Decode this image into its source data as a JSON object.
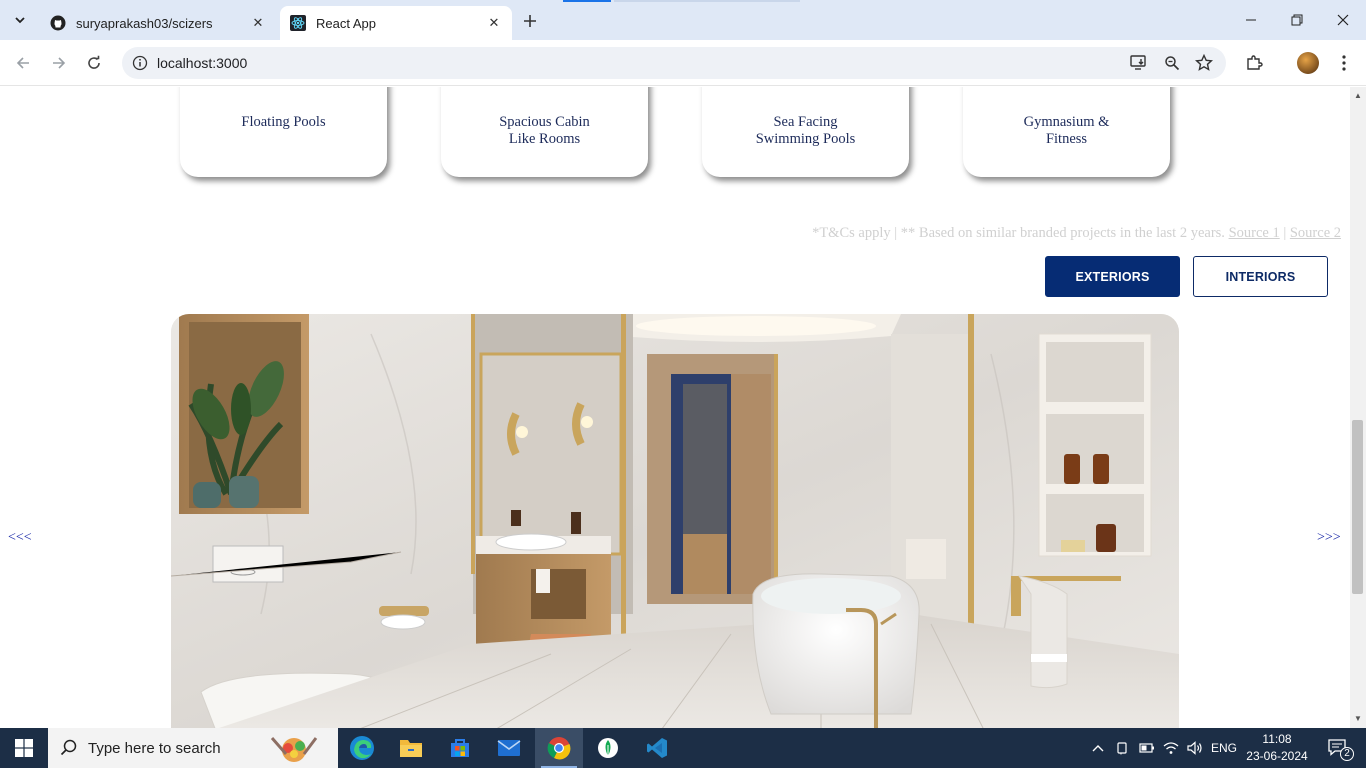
{
  "browser": {
    "tabs": [
      {
        "title": "suryaprakash03/scizers",
        "icon": "github-icon"
      },
      {
        "title": "React App",
        "icon": "react-icon"
      }
    ],
    "url": "localhost:3000",
    "window_controls": [
      "minimize",
      "restore",
      "close"
    ]
  },
  "page": {
    "amenities": [
      {
        "lines": [
          "Floating Pools"
        ]
      },
      {
        "lines": [
          "Spacious Cabin",
          "Like Rooms"
        ]
      },
      {
        "lines": [
          "Sea Facing",
          "Swimming Pools"
        ]
      },
      {
        "lines": [
          "Gymnasium &",
          "Fitness"
        ]
      }
    ],
    "terms_text": "*T&Cs apply | ** Based on similar branded projects in the last 2 years.",
    "source1": "Source 1",
    "sep": "|",
    "source2": "Source 2",
    "buttons": {
      "exteriors": "EXTERIORS",
      "interiors": "INTERIORS"
    },
    "carousel": {
      "prev": "<<<",
      "next": ">>>",
      "slide_alt": "Luxury bathroom interior"
    }
  },
  "taskbar": {
    "search_placeholder": "Type here to search",
    "language": "ENG",
    "time": "11:08",
    "date": "23-06-2024",
    "notification_count": "2"
  },
  "colors": {
    "primary": "#062c74",
    "label_text": "#1d2b5a",
    "arrow_link": "#1b2aa8",
    "tabstrip": "#dfe8f6",
    "taskbar": "#1c2e46"
  }
}
